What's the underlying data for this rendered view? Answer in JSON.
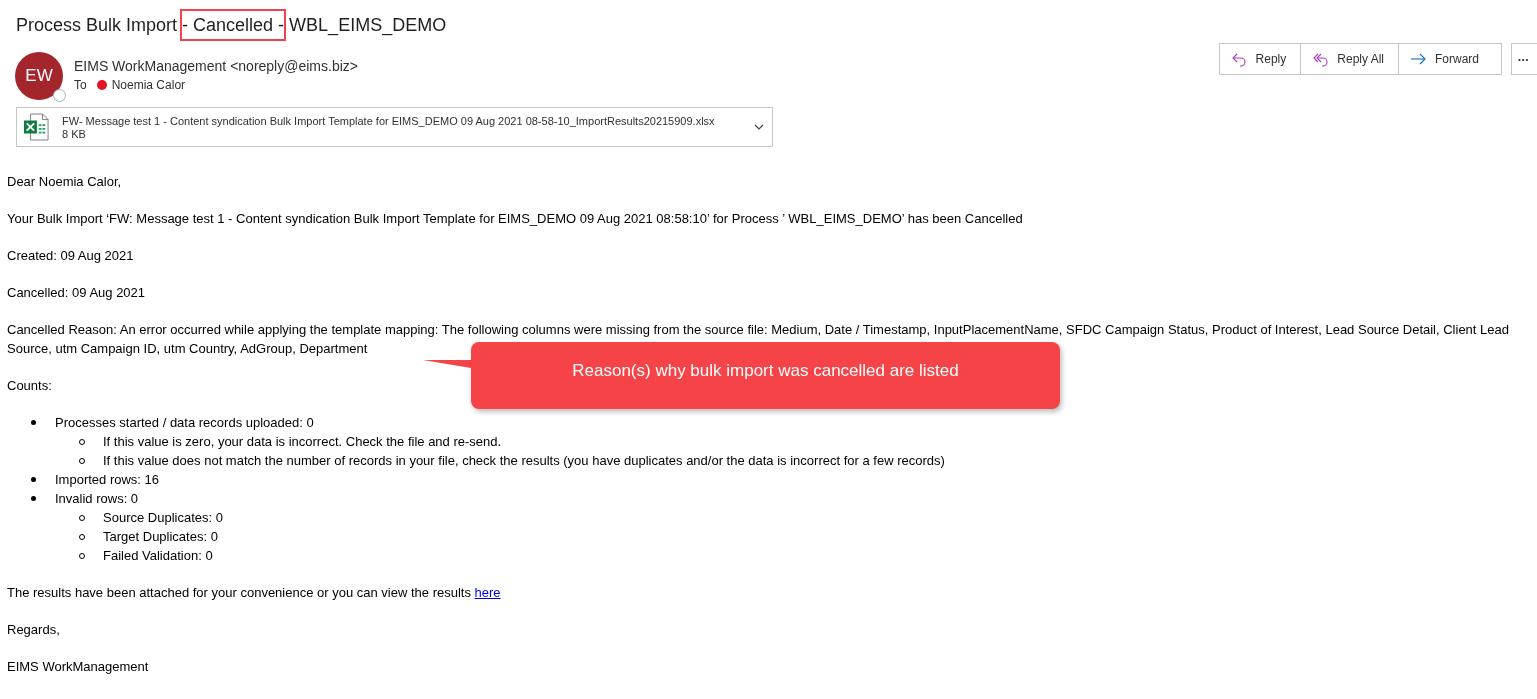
{
  "subject": {
    "before": "Process Bulk Import ",
    "highlighted": "- Cancelled -",
    "after": " WBL_EIMS_DEMO"
  },
  "sender": {
    "initials": "EW",
    "name": "EIMS WorkManagement <noreply@eims.biz>",
    "to_label": "To",
    "recipient": "Noemia Calor"
  },
  "actions": [
    {
      "label": "Reply",
      "kind": "reply"
    },
    {
      "label": "Reply All",
      "kind": "replyall"
    },
    {
      "label": "Forward",
      "kind": "forward"
    }
  ],
  "more": "•••",
  "attachment": {
    "name": "FW- Message test 1 - Content syndication Bulk Import Template for EIMS_DEMO 09 Aug 2021 08-58-10_ImportResults20215909.xlsx",
    "size": "8 KB"
  },
  "body": {
    "greeting": "Dear Noemia Calor,",
    "paragraphs": [
      "Your Bulk Import ‘FW: Message test 1 - Content syndication Bulk Import Template for EIMS_DEMO 09 Aug 2021 08:58:10’ for Process ’ WBL_EIMS_DEMO’ has been Cancelled",
      "Created: 09 Aug 2021",
      "Cancelled: 09 Aug 2021",
      "Cancelled Reason: An error occurred while applying the template mapping: The following columns were missing from the source file: Medium, Date / Timestamp, InputPlacementName, SFDC Campaign Status, Product of Interest, Lead Source Detail, Client Lead Source, utm Campaign ID, utm Country, AdGroup, Department",
      "Counts:"
    ],
    "counts": [
      {
        "text": "Processes started / data records uploaded: 0",
        "children": [
          {
            "text": "If this value is zero, your data is incorrect. Check the file and re-send."
          },
          {
            "text": "If this value does not match the number of records in your file, check the results (you have duplicates and/or the data is incorrect for a few records)"
          }
        ]
      },
      {
        "text": "Imported rows: 16"
      },
      {
        "text": "Invalid rows: 0",
        "children": [
          {
            "text": "Source Duplicates: 0"
          },
          {
            "text": "Target Duplicates: 0"
          },
          {
            "text": "Failed Validation: 0"
          }
        ]
      }
    ],
    "results_text": "The results have been attached for your convenience or you can view the results ",
    "results_link": "here",
    "closing": "Regards,",
    "signature": "EIMS WorkManagement"
  },
  "callout": "Reason(s) why bulk import was cancelled are listed"
}
